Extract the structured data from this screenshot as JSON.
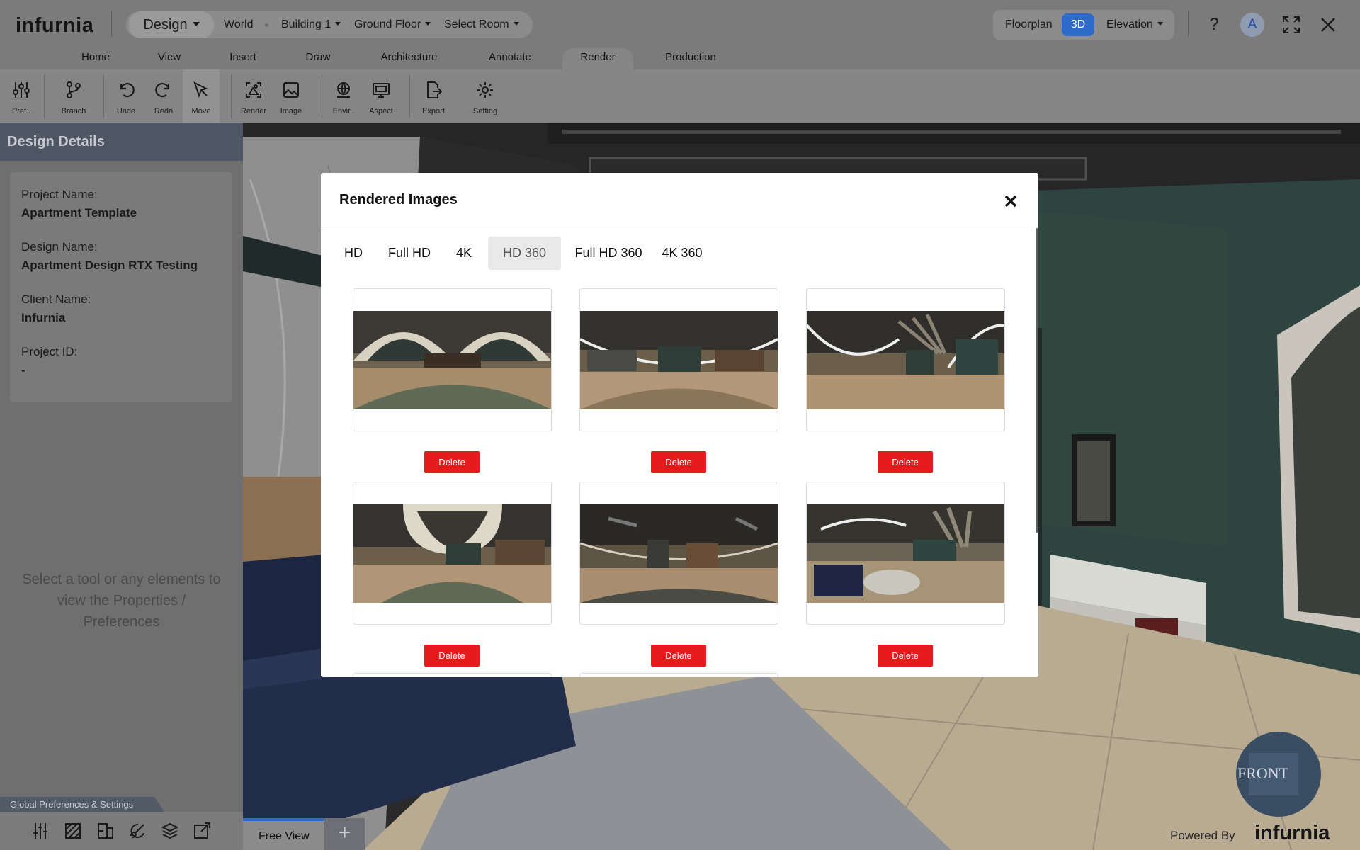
{
  "app": {
    "logo": "infurnia"
  },
  "breadcrumb": {
    "design": "Design",
    "world": "World",
    "building": "Building 1",
    "floor": "Ground Floor",
    "room": "Select Room"
  },
  "view_switch": {
    "floorplan": "Floorplan",
    "three_d": "3D",
    "elevation": "Elevation",
    "active": "3D"
  },
  "user": {
    "avatar_initial": "A"
  },
  "ribbon": {
    "tabs": [
      "Home",
      "View",
      "Insert",
      "Draw",
      "Architecture",
      "Annotate",
      "Render",
      "Production"
    ],
    "active_tab": "Render",
    "tools": [
      {
        "label": "Pref..",
        "icon": "sliders-icon"
      },
      {
        "label": "Branch",
        "icon": "branch-icon"
      },
      {
        "label": "Undo",
        "icon": "undo-icon"
      },
      {
        "label": "Redo",
        "icon": "redo-icon"
      },
      {
        "label": "Move",
        "icon": "cursor-icon"
      },
      {
        "label": "Render",
        "icon": "render-icon"
      },
      {
        "label": "Image",
        "icon": "image-icon"
      },
      {
        "label": "Envir..",
        "icon": "globe-icon"
      },
      {
        "label": "Aspect",
        "icon": "monitor-icon"
      },
      {
        "label": "Export",
        "icon": "export-icon"
      },
      {
        "label": "Setting",
        "icon": "gear-icon"
      }
    ]
  },
  "design_details": {
    "title": "Design Details",
    "fields": [
      {
        "label": "Project Name:",
        "value": "Apartment Template"
      },
      {
        "label": "Design Name:",
        "value": "Apartment Design RTX Testing"
      },
      {
        "label": "Client Name:",
        "value": "Infurnia"
      },
      {
        "label": "Project ID:",
        "value": "-"
      }
    ],
    "hint": "Select a tool or any elements to view the Properties / Preferences"
  },
  "global_prefs": {
    "label": "Global Preferences & Settings"
  },
  "view_tabs": {
    "current": "Free View",
    "add": "+"
  },
  "footer": {
    "powered_by": "Powered By",
    "logo": "infurnia"
  },
  "modal": {
    "title": "Rendered Images",
    "tabs": [
      "HD",
      "Full HD",
      "4K",
      "HD 360",
      "Full HD 360",
      "4K 360"
    ],
    "active_tab": "HD 360",
    "delete_label": "Delete",
    "image_count_visible": 6
  },
  "colors": {
    "accent": "#2d6ac9",
    "delete": "#e61c1c",
    "panel_header": "#4e5663"
  }
}
